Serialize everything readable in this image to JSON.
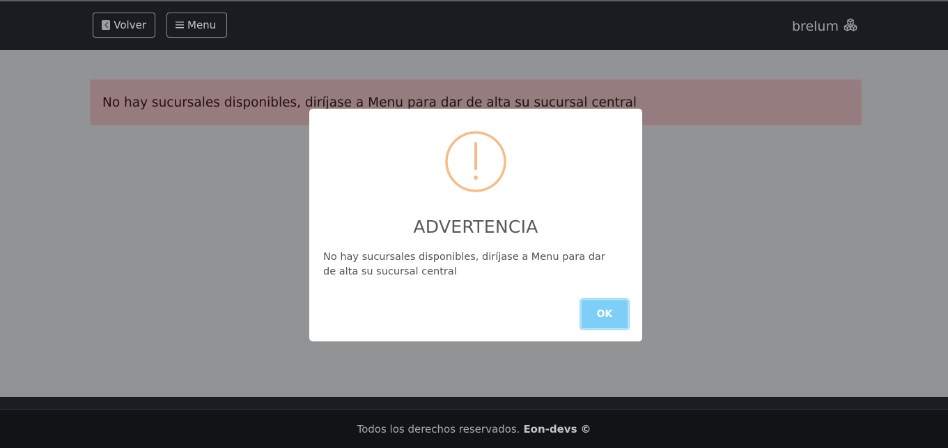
{
  "navbar": {
    "back_label": "Volver",
    "menu_label": "Menu",
    "brand_name": "brelum",
    "brand_icon": "boxes-icon",
    "menu_icon": "hamburger-icon",
    "back_icon": "arrow-left-square-icon"
  },
  "alert": {
    "message": "No hay sucursales disponibles, diríjase a Menu para dar de alta su sucursal central"
  },
  "modal": {
    "icon": "warning-icon",
    "title": "ADVERTENCIA",
    "text": "No hay sucursales disponibles, diríjase a Menu para dar de alta su sucursal central",
    "ok_label": "OK"
  },
  "footer": {
    "text": "Todos los derechos reservados.",
    "brand": "Eon-devs",
    "copyright": "©"
  },
  "colors": {
    "navbar_bg": "#191c20",
    "overlay_bg": "#929395",
    "warning_orange": "#f8bb86",
    "ok_button": "#7dcff7"
  }
}
